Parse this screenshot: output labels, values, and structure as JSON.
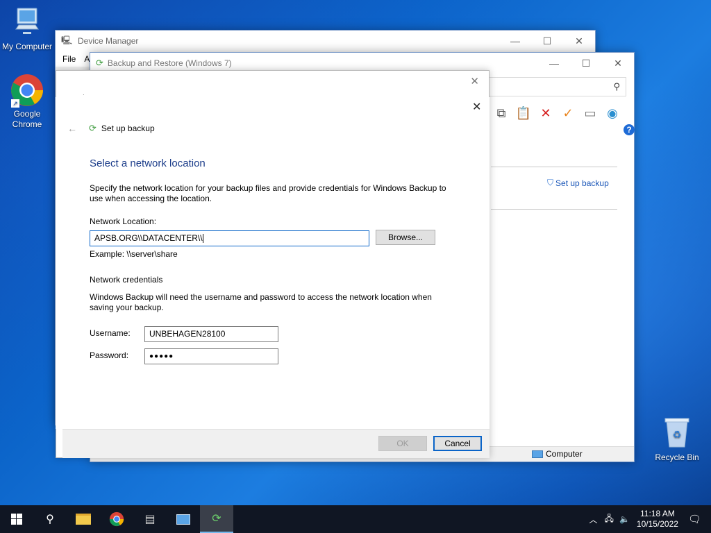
{
  "desktop": {
    "icons": [
      {
        "label": "My Computer"
      },
      {
        "label": "Google Chrome"
      },
      {
        "label": "Recycle Bin"
      }
    ]
  },
  "device_manager": {
    "title": "Device Manager",
    "menu": [
      "File",
      "A"
    ]
  },
  "backup_window": {
    "title": "Backup and Restore (Windows 7)",
    "setup_link": "Set up backup",
    "status_computer": "Computer"
  },
  "wizard": {
    "header": "Set up backup",
    "heading": "Select a network location",
    "intro": "Specify the network location for your backup files and provide credentials for Windows Backup to use when accessing the location.",
    "network_location_label": "Network Location:",
    "network_location_value": "APSB.ORG\\\\DATACENTER\\\\",
    "browse_label": "Browse...",
    "example": "Example: \\\\server\\share",
    "credentials_heading": "Network credentials",
    "credentials_text": "Windows Backup will need the username and password to access the network location when saving your backup.",
    "username_label": "Username:",
    "username_value": "UNBEHAGEN28100",
    "password_label": "Password:",
    "password_value": "●●●●●",
    "ok_label": "OK",
    "cancel_label": "Cancel"
  },
  "taskbar": {
    "time": "11:18 AM",
    "date": "10/15/2022"
  },
  "colors": {
    "accent": "#0a64c8",
    "heading": "#1c3d8a",
    "link": "#1a56b8",
    "taskbar": "#101623"
  }
}
